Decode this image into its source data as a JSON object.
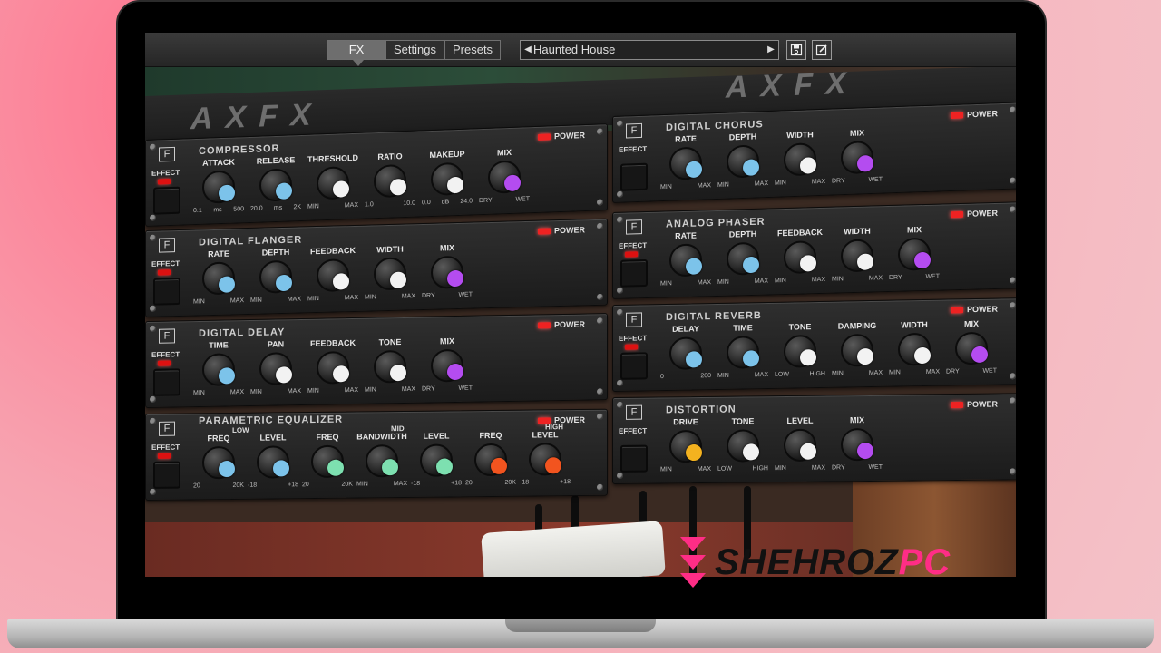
{
  "plugin": {
    "tabs": [
      {
        "label": "FX",
        "active": true
      },
      {
        "label": "Settings",
        "active": false
      },
      {
        "label": "Presets",
        "active": false
      }
    ],
    "preset_name": "Haunted House",
    "preset_prev_icon": "triangle-left",
    "preset_next_icon": "triangle-right",
    "save_icon": "save-icon",
    "edit_icon": "edit-icon",
    "rack_logo": "AXFX",
    "power_label": "POWER",
    "effect_label": "EFFECT",
    "modules": [
      {
        "title": "COMPRESSOR",
        "effect_on": true,
        "knobs": [
          {
            "label": "ATTACK",
            "min": "0.1",
            "max": "500",
            "unit": "ms",
            "color": "#7cc3ea"
          },
          {
            "label": "RELEASE",
            "min": "20.0",
            "max": "2K",
            "unit": "ms",
            "color": "#7cc3ea"
          },
          {
            "label": "THRESHOLD",
            "min": "MIN",
            "max": "MAX",
            "color": "#f2f2f2"
          },
          {
            "label": "RATIO",
            "min": "1.0",
            "max": "10.0",
            "color": "#f2f2f2"
          },
          {
            "label": "MAKEUP",
            "min": "0.0",
            "max": "24.0",
            "unit": "dB",
            "color": "#f2f2f2"
          },
          {
            "label": "MIX",
            "min": "DRY",
            "max": "WET",
            "color": "#b44cf0"
          }
        ]
      },
      {
        "title": "DIGITAL CHORUS",
        "effect_on": false,
        "knobs": [
          {
            "label": "RATE",
            "min": "MIN",
            "max": "MAX",
            "color": "#7cc3ea"
          },
          {
            "label": "DEPTH",
            "min": "MIN",
            "max": "MAX",
            "color": "#7cc3ea"
          },
          {
            "label": "WIDTH",
            "min": "MIN",
            "max": "MAX",
            "color": "#f2f2f2"
          },
          {
            "label": "MIX",
            "min": "DRY",
            "max": "WET",
            "color": "#b44cf0"
          }
        ]
      },
      {
        "title": "DIGITAL FLANGER",
        "effect_on": true,
        "knobs": [
          {
            "label": "RATE",
            "min": "MIN",
            "max": "MAX",
            "color": "#7cc3ea"
          },
          {
            "label": "DEPTH",
            "min": "MIN",
            "max": "MAX",
            "color": "#7cc3ea"
          },
          {
            "label": "FEEDBACK",
            "min": "MIN",
            "max": "MAX",
            "color": "#f2f2f2"
          },
          {
            "label": "WIDTH",
            "min": "MIN",
            "max": "MAX",
            "color": "#f2f2f2"
          },
          {
            "label": "MIX",
            "min": "DRY",
            "max": "WET",
            "color": "#b44cf0"
          }
        ]
      },
      {
        "title": "ANALOG PHASER",
        "effect_on": true,
        "knobs": [
          {
            "label": "RATE",
            "min": "MIN",
            "max": "MAX",
            "color": "#7cc3ea"
          },
          {
            "label": "DEPTH",
            "min": "MIN",
            "max": "MAX",
            "color": "#7cc3ea"
          },
          {
            "label": "FEEDBACK",
            "min": "MIN",
            "max": "MAX",
            "color": "#f2f2f2"
          },
          {
            "label": "WIDTH",
            "min": "MIN",
            "max": "MAX",
            "color": "#f2f2f2"
          },
          {
            "label": "MIX",
            "min": "DRY",
            "max": "WET",
            "color": "#b44cf0"
          }
        ]
      },
      {
        "title": "DIGITAL DELAY",
        "effect_on": true,
        "knobs": [
          {
            "label": "TIME",
            "min": "MIN",
            "max": "MAX",
            "color": "#7cc3ea"
          },
          {
            "label": "PAN",
            "min": "MIN",
            "max": "MAX",
            "color": "#f2f2f2"
          },
          {
            "label": "FEEDBACK",
            "min": "MIN",
            "max": "MAX",
            "color": "#f2f2f2"
          },
          {
            "label": "TONE",
            "min": "MIN",
            "max": "MAX",
            "color": "#f2f2f2"
          },
          {
            "label": "MIX",
            "min": "DRY",
            "max": "WET",
            "color": "#b44cf0"
          }
        ]
      },
      {
        "title": "DIGITAL REVERB",
        "effect_on": true,
        "knobs": [
          {
            "label": "DELAY",
            "min": "0",
            "max": "200",
            "color": "#7cc3ea"
          },
          {
            "label": "TIME",
            "min": "MIN",
            "max": "MAX",
            "color": "#7cc3ea"
          },
          {
            "label": "TONE",
            "min": "LOW",
            "max": "HIGH",
            "color": "#f2f2f2"
          },
          {
            "label": "DAMPING",
            "min": "MIN",
            "max": "MAX",
            "color": "#f2f2f2"
          },
          {
            "label": "WIDTH",
            "min": "MIN",
            "max": "MAX",
            "color": "#f2f2f2"
          },
          {
            "label": "MIX",
            "min": "DRY",
            "max": "WET",
            "color": "#b44cf0"
          }
        ]
      },
      {
        "title": "PARAMETRIC EQUALIZER",
        "effect_on": true,
        "knobs": [
          {
            "label": "FREQ",
            "min": "20",
            "max": "20K",
            "color": "#7cc3ea"
          },
          {
            "label": "LEVEL",
            "min": "-18",
            "max": "+18",
            "color": "#7cc3ea"
          },
          {
            "label": "FREQ",
            "min": "20",
            "max": "20K",
            "color": "#7de0b0"
          },
          {
            "label": "BANDWIDTH",
            "min": "MIN",
            "max": "MAX",
            "color": "#7de0b0"
          },
          {
            "label": "LEVEL",
            "min": "-18",
            "max": "+18",
            "color": "#7de0b0"
          },
          {
            "label": "FREQ",
            "min": "20",
            "max": "20K",
            "color": "#f2541f"
          },
          {
            "label": "LEVEL",
            "min": "-18",
            "max": "+18",
            "color": "#f2541f"
          }
        ],
        "band_labels": [
          "LOW",
          "MID",
          "HIGH"
        ]
      },
      {
        "title": "DISTORTION",
        "effect_on": false,
        "knobs": [
          {
            "label": "DRIVE",
            "min": "MIN",
            "max": "MAX",
            "color": "#f4b21f"
          },
          {
            "label": "TONE",
            "min": "LOW",
            "max": "HIGH",
            "color": "#f2f2f2"
          },
          {
            "label": "LEVEL",
            "min": "MIN",
            "max": "MAX",
            "color": "#f2f2f2"
          },
          {
            "label": "MIX",
            "min": "DRY",
            "max": "WET",
            "color": "#b44cf0"
          }
        ]
      }
    ]
  },
  "watermark": {
    "text_a": "SHEHROZ",
    "text_b": "PC",
    "color": "#ff2d86"
  }
}
